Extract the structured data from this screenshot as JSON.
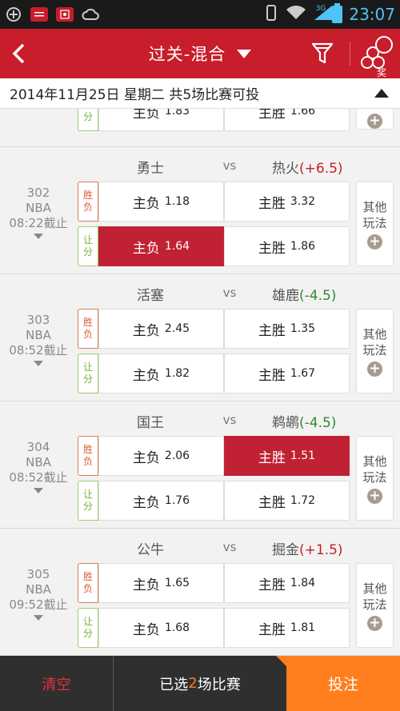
{
  "status_bar": {
    "time": "23:07",
    "network": "3G",
    "app_icons": [
      "add-circle-icon",
      "money-app-icon",
      "hongbao-app-icon",
      "cloud-icon"
    ]
  },
  "header": {
    "back_icon": "chevron-left-icon",
    "title": "过关-混合",
    "filter_icon": "funnel-icon",
    "prize_icon": "prize-balls-icon",
    "prize_label": "奖"
  },
  "date_bar": {
    "text": "2014年11月25日 星期二 共5场比赛可投"
  },
  "labels": {
    "vs": "vs",
    "win_lose_tag": [
      "胜",
      "负"
    ],
    "handicap_tag": [
      "让",
      "分"
    ],
    "other_play": [
      "其他",
      "玩法"
    ],
    "plus": "+"
  },
  "partial_row": {
    "tag": [
      "让",
      "分"
    ],
    "home_label": "主负",
    "home_odds": "1.83",
    "away_label": "主胜",
    "away_odds": "1.66"
  },
  "matches": [
    {
      "number": "302",
      "league": "NBA",
      "deadline": "08:22截止",
      "home": "勇士",
      "away": "热火",
      "handicap": "(+6.5)",
      "handicap_sign": "positive",
      "win_lose": {
        "home_label": "主负",
        "home_odds": "1.18",
        "away_label": "主胜",
        "away_odds": "3.32",
        "selected": "none"
      },
      "handicap_line": {
        "home_label": "主负",
        "home_odds": "1.64",
        "away_label": "主胜",
        "away_odds": "1.86",
        "selected": "home"
      }
    },
    {
      "number": "303",
      "league": "NBA",
      "deadline": "08:52截止",
      "home": "活塞",
      "away": "雄鹿",
      "handicap": "(-4.5)",
      "handicap_sign": "negative",
      "win_lose": {
        "home_label": "主负",
        "home_odds": "2.45",
        "away_label": "主胜",
        "away_odds": "1.35",
        "selected": "none"
      },
      "handicap_line": {
        "home_label": "主负",
        "home_odds": "1.82",
        "away_label": "主胜",
        "away_odds": "1.67",
        "selected": "none"
      }
    },
    {
      "number": "304",
      "league": "NBA",
      "deadline": "08:52截止",
      "home": "国王",
      "away": "鹈鹕",
      "handicap": "(-4.5)",
      "handicap_sign": "negative",
      "win_lose": {
        "home_label": "主负",
        "home_odds": "2.06",
        "away_label": "主胜",
        "away_odds": "1.51",
        "selected": "away"
      },
      "handicap_line": {
        "home_label": "主负",
        "home_odds": "1.76",
        "away_label": "主胜",
        "away_odds": "1.72",
        "selected": "none"
      }
    },
    {
      "number": "305",
      "league": "NBA",
      "deadline": "09:52截止",
      "home": "公牛",
      "away": "掘金",
      "handicap": "(+1.5)",
      "handicap_sign": "positive",
      "win_lose": {
        "home_label": "主负",
        "home_odds": "1.65",
        "away_label": "主胜",
        "away_odds": "1.84",
        "selected": "none"
      },
      "handicap_line": {
        "home_label": "主负",
        "home_odds": "1.68",
        "away_label": "主胜",
        "away_odds": "1.81",
        "selected": "none"
      }
    }
  ],
  "bottom_bar": {
    "clear_label": "清空",
    "selected_prefix": "已选",
    "selected_count": "2",
    "selected_suffix": "场比赛",
    "submit_label": "投注"
  },
  "colors": {
    "brand_red": "#c81d2b",
    "selected_cell": "#c12233",
    "submit_orange": "#ff7e1d",
    "handicap_positive": "#c81d2b",
    "handicap_negative": "#2e8b2e"
  }
}
